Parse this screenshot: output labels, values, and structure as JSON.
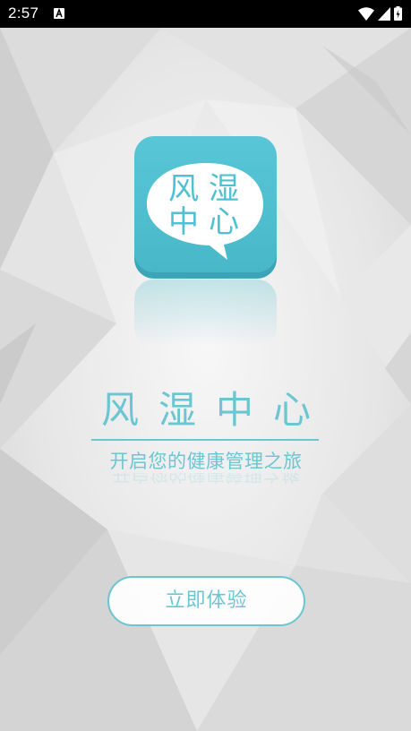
{
  "status_bar": {
    "time": "2:57",
    "notification_icon": "a-notification-icon",
    "icons": [
      "wifi-icon",
      "cellular-signal-icon",
      "battery-charging-icon"
    ]
  },
  "logo": {
    "chars_line1": [
      "风",
      "湿"
    ],
    "chars_line2": [
      "中",
      "心"
    ],
    "icon": "speech-bubble-icon",
    "colors": {
      "tile": "#4fc1d2",
      "tile_shadow": "#3aa5b6",
      "bubble": "#ffffff",
      "text": "#4fc1d2"
    }
  },
  "title": "风湿中心",
  "slogan": "开启您的健康管理之旅",
  "start_button": {
    "label": "立即体验"
  },
  "colors": {
    "accent": "#6cc6d2",
    "status_bar": "#000000",
    "background": "#e9e9e9"
  }
}
